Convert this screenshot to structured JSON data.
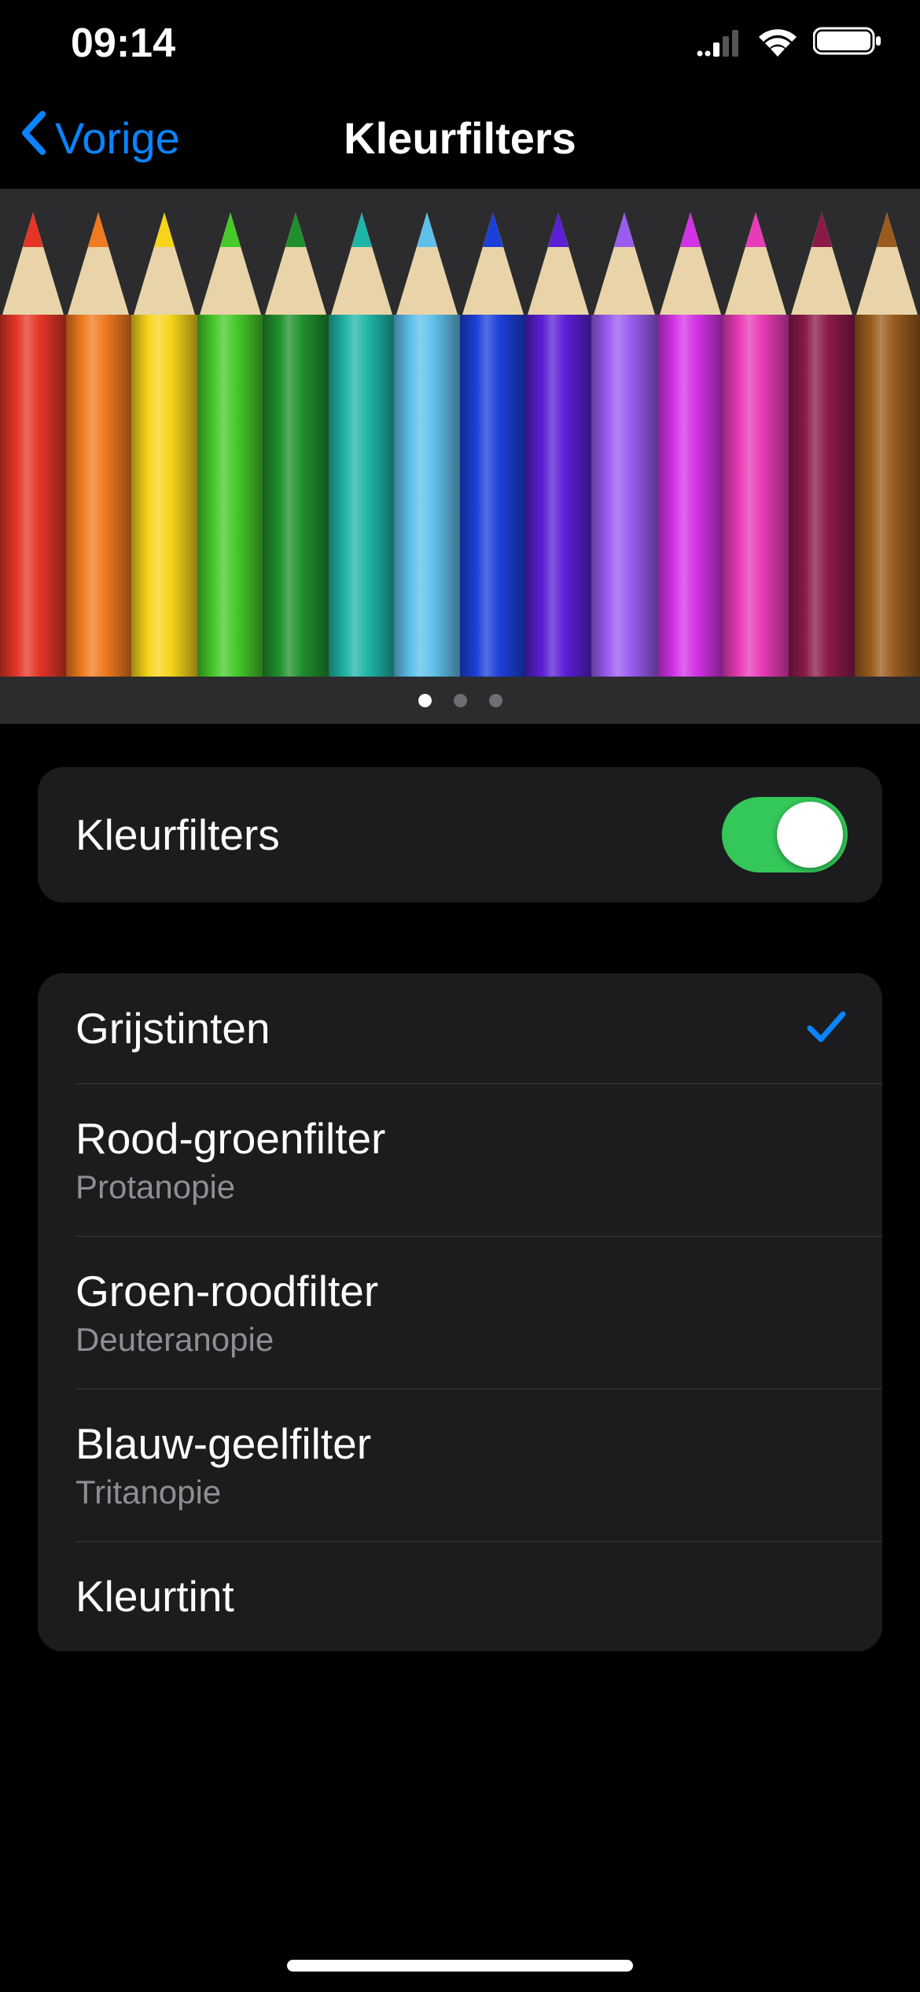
{
  "status": {
    "time": "09:14"
  },
  "nav": {
    "back_label": "Vorige",
    "title": "Kleurfilters"
  },
  "preview": {
    "pencil_colors": [
      "#e43526",
      "#f07a1f",
      "#f6d41a",
      "#47c92a",
      "#1f8f2c",
      "#1fb5a7",
      "#5ec0ea",
      "#1b3fd8",
      "#5b1fd6",
      "#9a5cf0",
      "#d332e6",
      "#e83bb8",
      "#8b1a4a",
      "#9a5b1e"
    ],
    "page_count": 3,
    "active_page": 0
  },
  "toggle": {
    "label": "Kleurfilters",
    "on": true
  },
  "options": [
    {
      "title": "Grijstinten",
      "subtitle": null,
      "selected": true
    },
    {
      "title": "Rood-groenfilter",
      "subtitle": "Protanopie",
      "selected": false
    },
    {
      "title": "Groen-roodfilter",
      "subtitle": "Deuteranopie",
      "selected": false
    },
    {
      "title": "Blauw-geelfilter",
      "subtitle": "Tritanopie",
      "selected": false
    },
    {
      "title": "Kleurtint",
      "subtitle": null,
      "selected": false
    }
  ]
}
